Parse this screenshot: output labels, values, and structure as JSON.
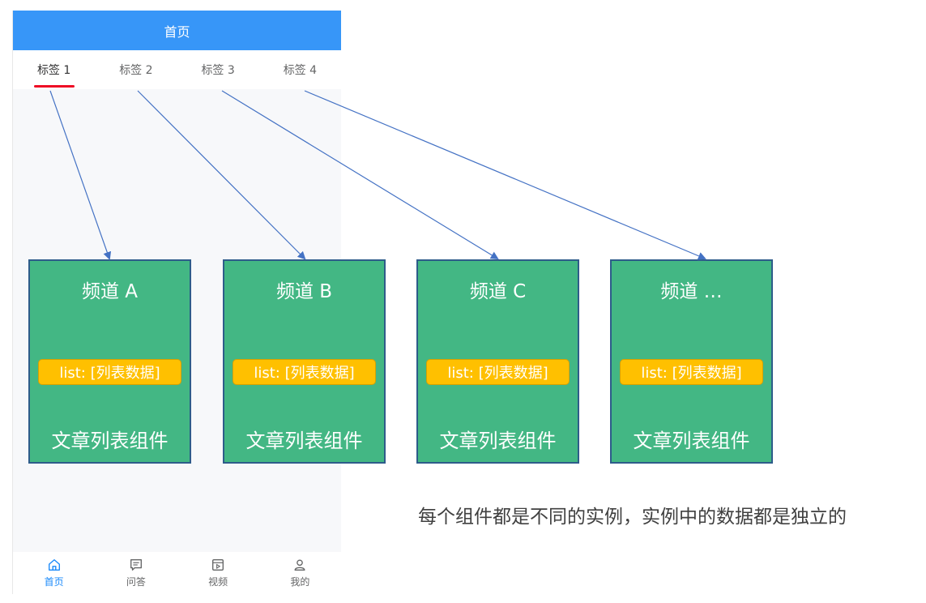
{
  "navbar": {
    "title": "首页"
  },
  "tabs": [
    {
      "label": "标签 1",
      "active": true
    },
    {
      "label": "标签 2",
      "active": false
    },
    {
      "label": "标签 3",
      "active": false
    },
    {
      "label": "标签 4",
      "active": false
    }
  ],
  "tabbar": [
    {
      "label": "首页",
      "icon": "home-icon",
      "active": true
    },
    {
      "label": "问答",
      "icon": "message-icon",
      "active": false
    },
    {
      "label": "视频",
      "icon": "video-icon",
      "active": false
    },
    {
      "label": "我的",
      "icon": "user-icon",
      "active": false
    }
  ],
  "channels": [
    {
      "title": "频道 A",
      "list_label": "list: [列表数据]",
      "footer": "文章列表组件"
    },
    {
      "title": "频道 B",
      "list_label": "list: [列表数据]",
      "footer": "文章列表组件"
    },
    {
      "title": "频道 C",
      "list_label": "list: [列表数据]",
      "footer": "文章列表组件"
    },
    {
      "title": "频道 …",
      "list_label": "list: [列表数据]",
      "footer": "文章列表组件"
    }
  ],
  "note": "每个组件都是不同的实例，实例中的数据都是独立的",
  "colors": {
    "navbar": "#3796f8",
    "tab_underline": "#ee0a24",
    "channel_fill": "#43b784",
    "channel_border": "#2e5c8a",
    "list_pill": "#ffc000",
    "arrow": "#4472c4",
    "tabbar_active": "#1989fa"
  }
}
